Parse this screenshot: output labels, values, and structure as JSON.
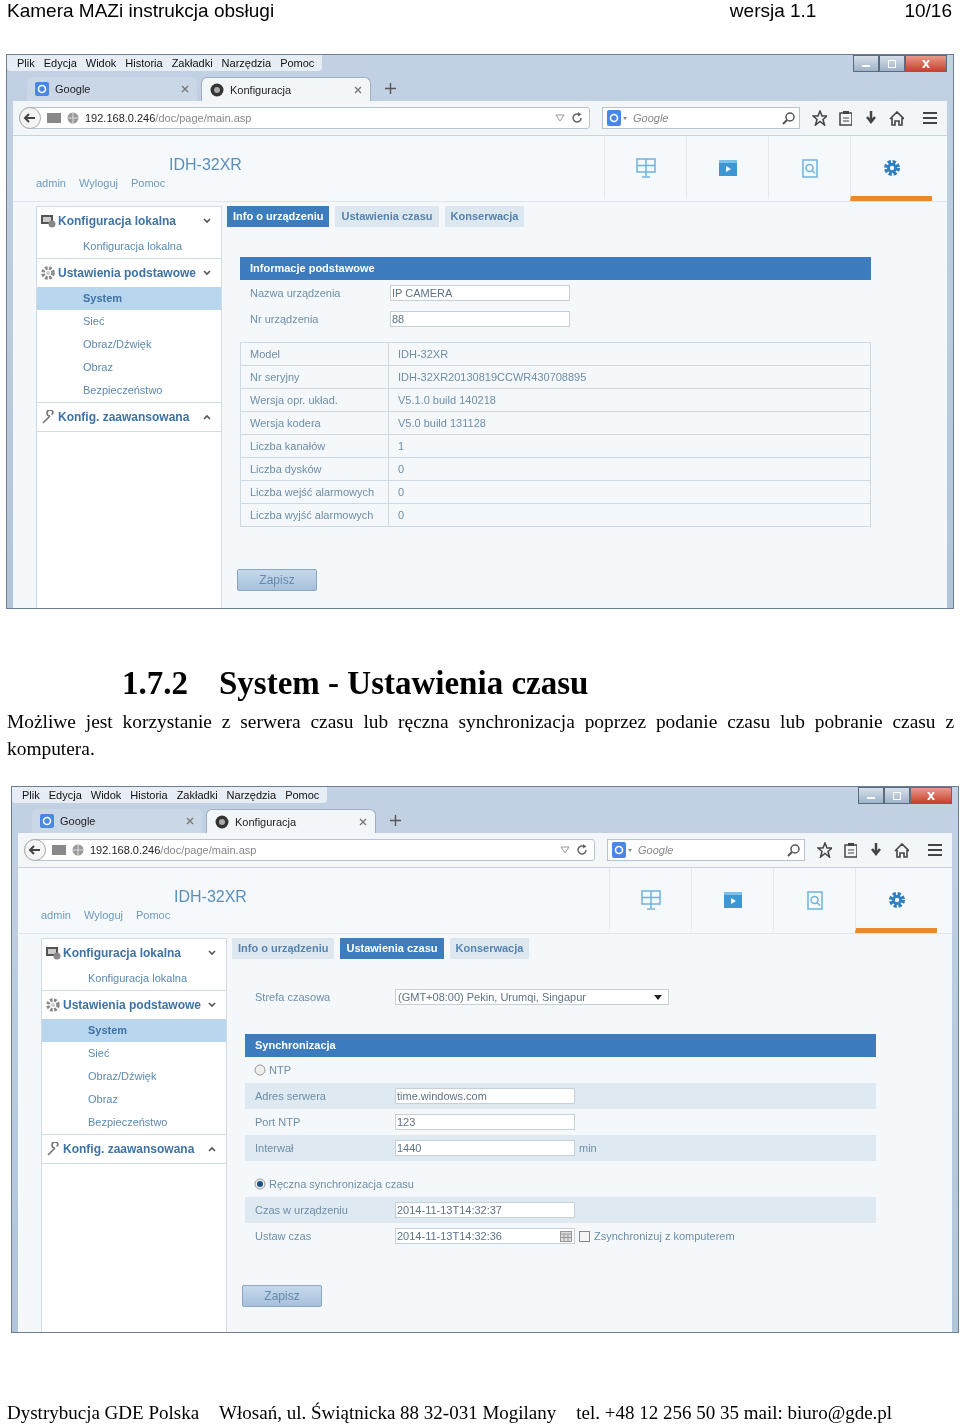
{
  "header": {
    "title": "Kamera MAZi instrukcja obsługi",
    "version": "wersja 1.1",
    "page": "10/16"
  },
  "screenshots": [
    {
      "menu": [
        "Plik",
        "Edycja",
        "Widok",
        "Historia",
        "Zakładki",
        "Narzędzia",
        "Pomoc"
      ],
      "tabs": [
        {
          "label": "Google",
          "kind": "google",
          "selected": false
        },
        {
          "label": "Konfiguracja",
          "kind": "camera",
          "selected": true
        }
      ],
      "url": "**192.168.0.246**/doc/page/main.asp",
      "search_placeholder": "Google",
      "device": "IDH-32XR",
      "user_links": [
        "admin",
        "Wyloguj",
        "Pomoc"
      ],
      "nav_icons": [
        {
          "kind": "live",
          "selected": false
        },
        {
          "kind": "playback",
          "selected": false
        },
        {
          "kind": "search",
          "selected": false
        },
        {
          "kind": "config",
          "selected": true
        }
      ],
      "sidebar": [
        {
          "label": "Konfiguracja lokalna",
          "kind": "local",
          "expanded": true,
          "children": [
            {
              "label": "Konfiguracja lokalna",
              "selected": false
            }
          ]
        },
        {
          "label": "Ustawienia podstawowe",
          "kind": "basic",
          "expanded": true,
          "children": [
            {
              "label": "System",
              "selected": true
            },
            {
              "label": "Sieć",
              "selected": false
            },
            {
              "label": "Obraz/Dźwięk",
              "selected": false
            },
            {
              "label": "Obraz",
              "selected": false
            },
            {
              "label": "Bezpieczeństwo",
              "selected": false
            }
          ]
        },
        {
          "label": "Konfig. zaawansowana",
          "kind": "advanced",
          "expanded": false
        }
      ],
      "page_tabs": [
        {
          "label": "Info o urządzeniu",
          "selected": true
        },
        {
          "label": "Ustawienia czasu",
          "selected": false
        },
        {
          "label": "Konserwacja",
          "selected": false
        }
      ],
      "content": {
        "kind": "info",
        "section_title": "Informacje podstawowe",
        "fields": [
          {
            "label": "Nazwa urządzenia",
            "value": "IP CAMERA"
          },
          {
            "label": "Nr urządzenia",
            "value": "88"
          }
        ],
        "table": [
          {
            "label": "Model",
            "value": "IDH-32XR"
          },
          {
            "label": "Nr seryjny",
            "value": "IDH-32XR20130819CCWR430708895"
          },
          {
            "label": "Wersja opr. układ.",
            "value": "V5.1.0 build 140218"
          },
          {
            "label": "Wersja kodera",
            "value": "V5.0 build 131128"
          },
          {
            "label": "Liczba kanałów",
            "value": "1"
          },
          {
            "label": "Liczba dysków",
            "value": "0"
          },
          {
            "label": "Liczba wejść alarmowych",
            "value": "0"
          },
          {
            "label": "Liczba wyjść alarmowych",
            "value": "0"
          }
        ],
        "save": "Zapisz"
      }
    },
    {
      "menu": [
        "Plik",
        "Edycja",
        "Widok",
        "Historia",
        "Zakładki",
        "Narzędzia",
        "Pomoc"
      ],
      "tabs": [
        {
          "label": "Google",
          "kind": "google",
          "selected": false
        },
        {
          "label": "Konfiguracja",
          "kind": "camera",
          "selected": true
        }
      ],
      "url": "**192.168.0.246**/doc/page/main.asp",
      "search_placeholder": "Google",
      "device": "IDH-32XR",
      "user_links": [
        "admin",
        "Wyloguj",
        "Pomoc"
      ],
      "nav_icons": [
        {
          "kind": "live",
          "selected": false
        },
        {
          "kind": "playback",
          "selected": false
        },
        {
          "kind": "search",
          "selected": false
        },
        {
          "kind": "config",
          "selected": true
        }
      ],
      "sidebar": [
        {
          "label": "Konfiguracja lokalna",
          "kind": "local",
          "expanded": true,
          "children": [
            {
              "label": "Konfiguracja lokalna",
              "selected": false
            }
          ]
        },
        {
          "label": "Ustawienia podstawowe",
          "kind": "basic",
          "expanded": true,
          "children": [
            {
              "label": "System",
              "selected": true
            },
            {
              "label": "Sieć",
              "selected": false
            },
            {
              "label": "Obraz/Dźwięk",
              "selected": false
            },
            {
              "label": "Obraz",
              "selected": false
            },
            {
              "label": "Bezpieczeństwo",
              "selected": false
            }
          ]
        },
        {
          "label": "Konfig. zaawansowana",
          "kind": "advanced",
          "expanded": false
        }
      ],
      "page_tabs": [
        {
          "label": "Info o urządzeniu",
          "selected": false
        },
        {
          "label": "Ustawienia czasu",
          "selected": true
        },
        {
          "label": "Konserwacja",
          "selected": false
        }
      ],
      "content": {
        "kind": "time",
        "timezone": {
          "label": "Strefa czasowa",
          "value": "(GMT+08:00) Pekin, Urumqi, Singapur"
        },
        "section_title": "Synchronizacja",
        "modes": [
          {
            "label": "NTP",
            "selected": false,
            "rows": [
              {
                "label": "Adres serwera",
                "value": "time.windows.com"
              },
              {
                "label": "Port NTP",
                "value": "123"
              },
              {
                "label": "Interwał",
                "value": "1440",
                "unit": "min"
              }
            ]
          },
          {
            "label": "Ręczna synchronizacja czasu",
            "selected": true,
            "rows": [
              {
                "label": "Czas w urządzeniu",
                "value": "2014-11-13T14:32:37"
              },
              {
                "label": "Ustaw czas",
                "value": "2014-11-13T14:32:36",
                "kind": "date",
                "checkbox": {
                  "label": "Zsynchronizuj z komputerem",
                  "checked": false
                }
              }
            ]
          }
        ],
        "save": "Zapisz"
      }
    }
  ],
  "section": {
    "number": "1.7.2",
    "title": "System - Ustawienia czasu",
    "text": "Możliwe jest korzystanie z serwera czasu lub ręczna synchronizacja poprzez podanie czasu lub pobranie czasu z komputera."
  },
  "footer": [
    "Dystrybucja GDE Polska",
    "Włosań, ul. Świątnicka 88 32-031 Mogilany",
    "tel. +48 12 256 50 35 mail: biuro@gde.pl"
  ]
}
